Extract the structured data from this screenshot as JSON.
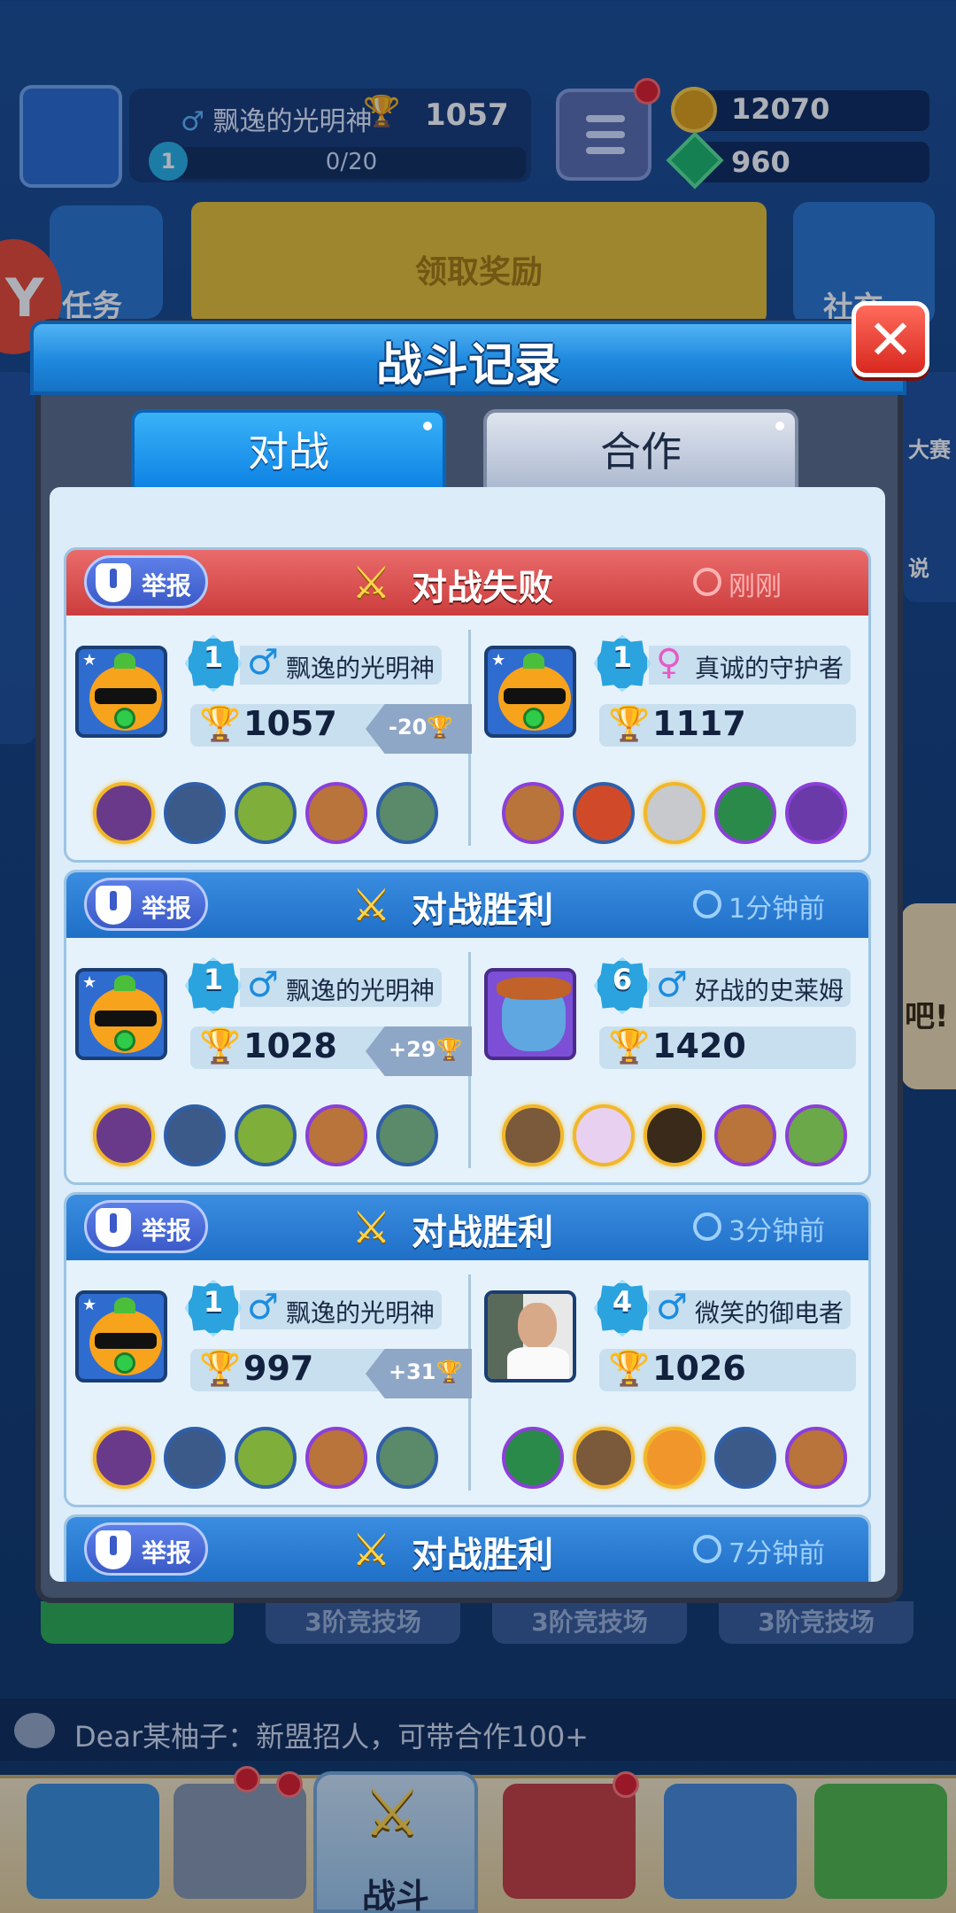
{
  "hud": {
    "player_name": "飘逸的光明神",
    "gender": "♂",
    "trophies": "1057",
    "level": "1",
    "xp": "0/20",
    "coins": "12070",
    "gems": "960"
  },
  "background": {
    "task_label": "任务",
    "reward_label": "领取奖励",
    "social_label": "社交",
    "side_label_1": "大赛",
    "side_label_2": "说",
    "side_right_text": "吧!",
    "footer_buttons": [
      "3阶竞技场",
      "3阶竞技场",
      "3阶竞技场"
    ]
  },
  "chat": {
    "message": "Dear某柚子：新盟招人，可带合作100+"
  },
  "bottom_nav": {
    "active_label": "战斗"
  },
  "modal": {
    "title": "战斗记录",
    "close_glyph": "✕",
    "tabs": [
      {
        "label": "对战",
        "active": true
      },
      {
        "label": "合作",
        "active": false
      }
    ],
    "report_label": "举报",
    "records": [
      {
        "result": "对战失败",
        "type": "loss",
        "time": "刚刚",
        "left": {
          "level": "1",
          "gender": "♂",
          "name": "飘逸的光明神",
          "trophies": "1057",
          "delta": "-20🏆"
        },
        "right": {
          "level": "1",
          "gender": "♀",
          "name": "真诚的守护者",
          "trophies": "1117"
        }
      },
      {
        "result": "对战胜利",
        "type": "win",
        "time": "1分钟前",
        "left": {
          "level": "1",
          "gender": "♂",
          "name": "飘逸的光明神",
          "trophies": "1028",
          "delta": "+29🏆"
        },
        "right": {
          "level": "6",
          "gender": "♂",
          "name": "好战的史莱姆",
          "trophies": "1420"
        }
      },
      {
        "result": "对战胜利",
        "type": "win",
        "time": "3分钟前",
        "left": {
          "level": "1",
          "gender": "♂",
          "name": "飘逸的光明神",
          "trophies": "997",
          "delta": "+31🏆"
        },
        "right": {
          "level": "4",
          "gender": "♂",
          "name": "微笑的御电者",
          "trophies": "1026"
        }
      },
      {
        "result": "对战胜利",
        "type": "win",
        "time": "7分钟前"
      }
    ]
  },
  "colors": {
    "loss_header": "#cc3d3d",
    "win_header": "#1f6fc7",
    "tab_active": "#0d83e4",
    "gold": "#f1b72a"
  }
}
